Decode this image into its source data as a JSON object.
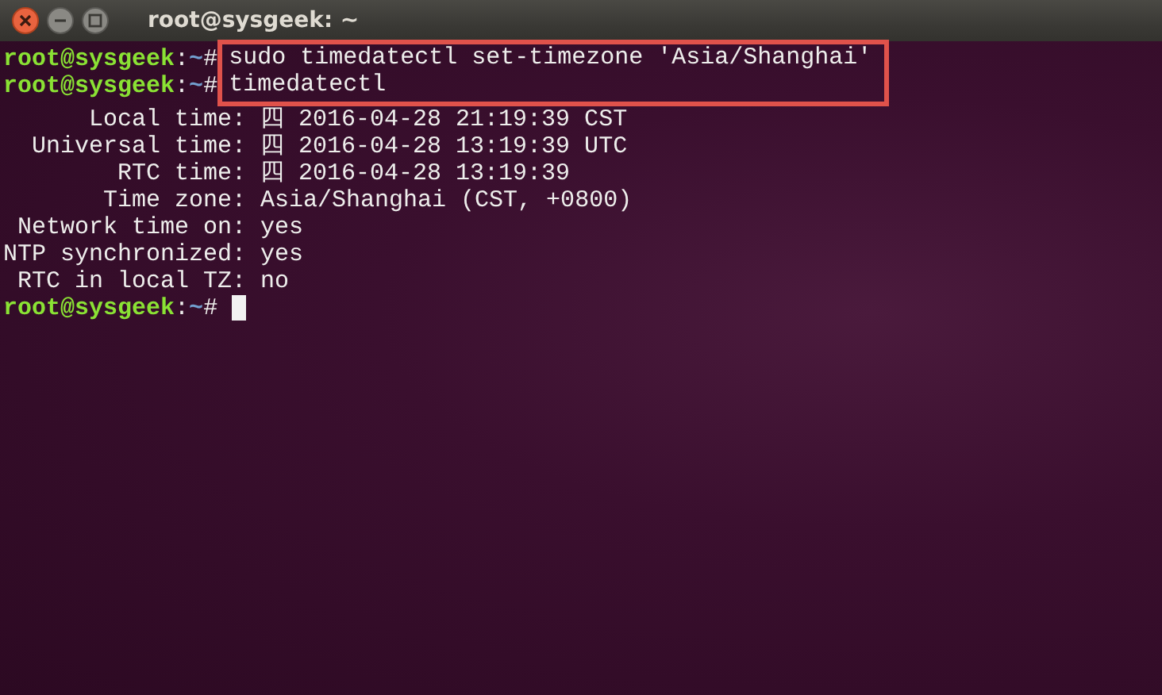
{
  "window": {
    "title": "root@sysgeek: ~"
  },
  "terminal": {
    "lines": [
      {
        "kind": "command",
        "user_host": "root@sysgeek",
        "separator": ":",
        "path": "~",
        "symbol": "#",
        "command": "sudo timedatectl set-timezone 'Asia/Shanghai'",
        "highlighted": true
      },
      {
        "kind": "command",
        "user_host": "root@sysgeek",
        "separator": ":",
        "path": "~",
        "symbol": "#",
        "command": "timedatectl",
        "highlighted": true
      },
      {
        "kind": "output",
        "label": "Local time:",
        "value": "四 2016-04-28 21:19:39 CST"
      },
      {
        "kind": "output",
        "label": "Universal time:",
        "value": "四 2016-04-28 13:19:39 UTC"
      },
      {
        "kind": "output",
        "label": "RTC time:",
        "value": "四 2016-04-28 13:19:39"
      },
      {
        "kind": "output",
        "label": "Time zone:",
        "value": "Asia/Shanghai (CST, +0800)"
      },
      {
        "kind": "output",
        "label": "Network time on:",
        "value": "yes"
      },
      {
        "kind": "output",
        "label": "NTP synchronized:",
        "value": "yes"
      },
      {
        "kind": "output",
        "label": "RTC in local TZ:",
        "value": "no"
      },
      {
        "kind": "prompt",
        "user_host": "root@sysgeek",
        "separator": ":",
        "path": "~",
        "symbol": "#",
        "cursor": true
      }
    ]
  }
}
